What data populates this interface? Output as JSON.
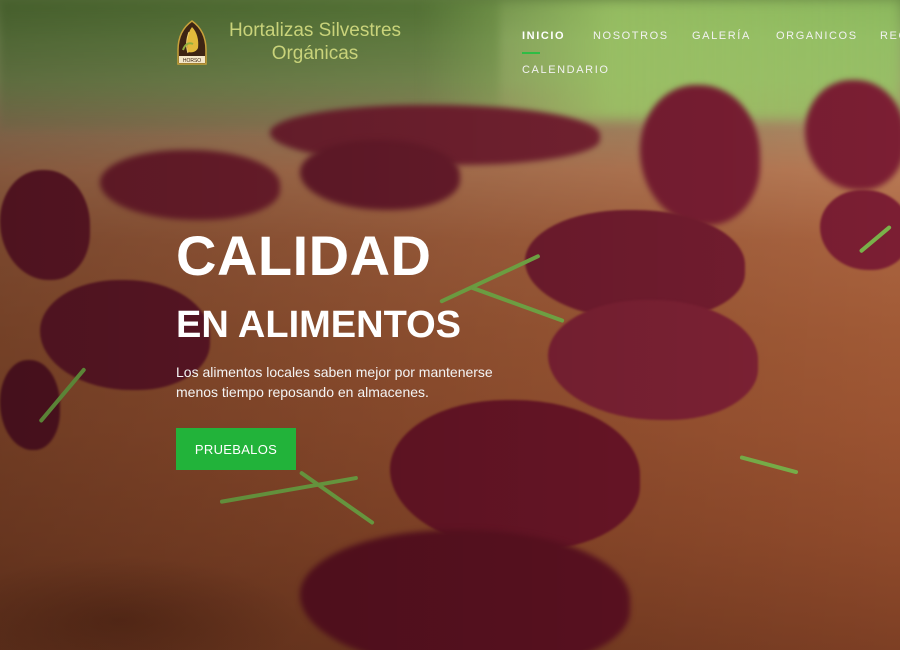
{
  "brand": {
    "logo_text": "HORSO",
    "name_line1": "Hortalizas Silvestres",
    "name_line2": "Orgánicas"
  },
  "nav": {
    "items": [
      {
        "label": "INICIO",
        "active": true
      },
      {
        "label": "NOSOTROS"
      },
      {
        "label": "GALERÍA"
      },
      {
        "label": "ORGANICOS"
      },
      {
        "label": "REC"
      },
      {
        "label": "CALENDARIO"
      }
    ]
  },
  "hero": {
    "title_line1": "CALIDAD",
    "title_line2": "EN ALIMENTOS",
    "lead": "Los alimentos locales saben mejor por mantenerse menos tiempo reposando en almacenes.",
    "cta_label": "PRUEBALOS"
  },
  "colors": {
    "accent": "#22b33a",
    "brand_text": "#c9d37a",
    "lettuce": "#6f1b2c",
    "soil": "#a15a36"
  }
}
